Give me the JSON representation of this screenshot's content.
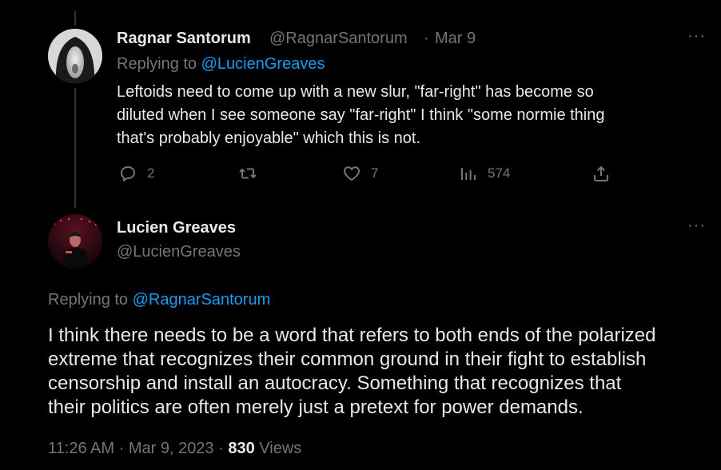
{
  "reply_tweet": {
    "display_name": "Ragnar Santorum",
    "handle": "@RagnarSantorum",
    "separator": "·",
    "date": "Mar 9",
    "replying_to_prefix": "Replying to ",
    "replying_to_handle": "@LucienGreaves",
    "text_lines": [
      "Leftoids need to come up with a new slur, \"far-right\" has become so",
      "diluted when I see someone say \"far-right\" I think \"some normie thing",
      "that's probably enjoyable\" which this is not."
    ],
    "actions": {
      "replies": "2",
      "retweets": "",
      "likes": "7",
      "views": "574"
    },
    "more_label": "···"
  },
  "main_tweet": {
    "display_name": "Lucien Greaves",
    "handle": "@LucienGreaves",
    "replying_to_prefix": "Replying to ",
    "replying_to_handle": "@RagnarSantorum",
    "text_lines": [
      "I think there needs to be a word that refers to both ends of the polarized",
      "extreme that recognizes their common ground in their fight to establish",
      "censorship and install an autocracy. Something that recognizes that",
      "their politics are often merely just a pretext for power demands."
    ],
    "time": "11:26 AM",
    "separator": "·",
    "date": "Mar 9, 2023",
    "separator2": "·",
    "views_count": "830",
    "views_label": "Views",
    "more_label": "···"
  },
  "icons": [
    "reply-icon",
    "retweet-icon",
    "like-icon",
    "views-icon",
    "share-icon",
    "more-icon"
  ],
  "colors": {
    "background": "#000000",
    "text": "#e7e9ea",
    "muted": "#71767b",
    "link": "#1d9bf0",
    "thread_line": "#333639"
  }
}
